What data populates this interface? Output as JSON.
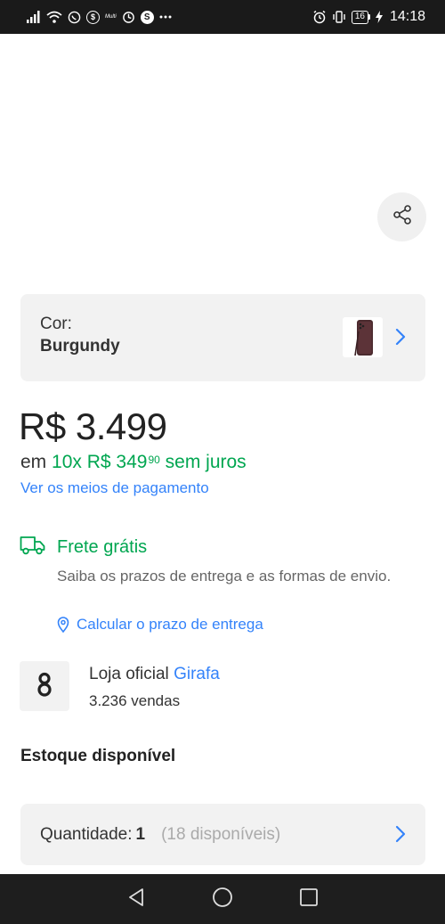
{
  "status_bar": {
    "time": "14:18",
    "battery": "16",
    "multi_label": "Multi",
    "s_icon_label": "S"
  },
  "product": {
    "color_label": "Cor:",
    "color_value": "Burgundy",
    "price": "R$ 3.499",
    "installments_prefix": "em",
    "installments_main": "10x R$ 349",
    "installments_cents": "90",
    "installments_suffix": "sem juros",
    "payment_link": "Ver os meios de pagamento"
  },
  "shipping": {
    "title": "Frete grátis",
    "description": "Saiba os prazos de entrega e as formas de envio.",
    "calc_link": "Calcular o prazo de entrega"
  },
  "seller": {
    "prefix": "Loja oficial",
    "name": "Girafa",
    "sales": "3.236 vendas"
  },
  "stock": {
    "title": "Estoque disponível",
    "quantity_label": "Quantidade:",
    "quantity_value": "1",
    "available": "(18 disponíveis)"
  },
  "colors": {
    "accent_blue": "#3483fa",
    "success_green": "#00a650"
  },
  "icons": {
    "share": "share-icon",
    "chevron": "chevron-right-icon",
    "truck": "truck-icon",
    "pin": "location-pin-icon",
    "seller_logo": "girafa-logo"
  }
}
